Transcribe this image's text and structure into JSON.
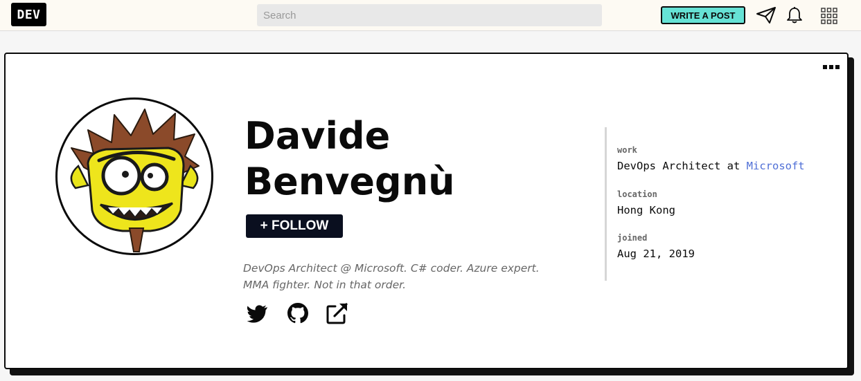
{
  "header": {
    "logo_text": "DEV",
    "search_placeholder": "Search",
    "write_post_label": "WRITE A POST",
    "icons": [
      "paper-plane-icon",
      "bell-icon",
      "apps-grid-icon"
    ]
  },
  "profile": {
    "name": "Davide Benvegnù",
    "follow_label": "+ FOLLOW",
    "summary": "DevOps Architect @ Microsoft. C# coder. Azure expert. MMA fighter. Not in that order.",
    "social_icons": [
      "twitter-icon",
      "github-icon",
      "external-link-icon"
    ],
    "menu_icon": "more-horizontal-icon"
  },
  "details": {
    "work_label": "work",
    "work_prefix": "DevOps Architect at",
    "work_company": "Microsoft",
    "location_label": "location",
    "location_value": "Hong Kong",
    "joined_label": "joined",
    "joined_value": "Aug 21, 2019"
  },
  "colors": {
    "accent": "#66e2d5",
    "follow_bg": "#0a0f1f",
    "link": "#4e6ed6",
    "topbar_bg": "#fdfaf3"
  }
}
